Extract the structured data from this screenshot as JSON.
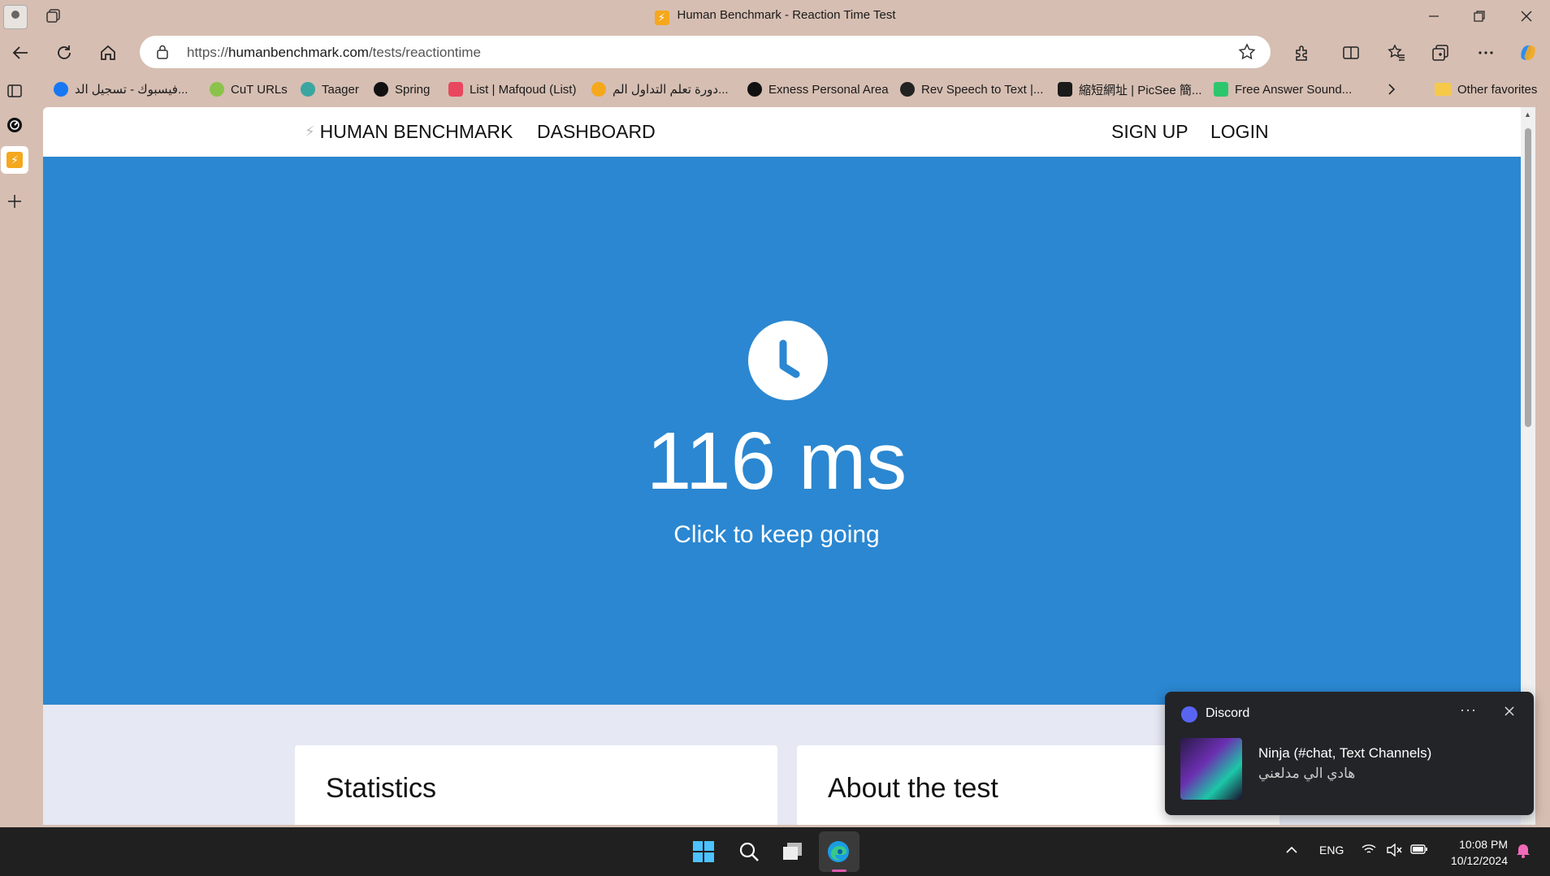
{
  "window": {
    "title": "Human Benchmark - Reaction Time Test"
  },
  "address_bar": {
    "url_prefix": "https://",
    "url_domain": "humanbenchmark.com",
    "url_path": "/tests/reactiontime"
  },
  "favorites": [
    {
      "label": "فيسبوك - تسجيل الد...",
      "icon": "facebook-icon",
      "color": "#1877f2"
    },
    {
      "label": "CuT URLs",
      "icon": "cut-urls-icon",
      "color": "#8bc34a"
    },
    {
      "label": "Taager",
      "icon": "taager-icon",
      "color": "#3aa6a0"
    },
    {
      "label": "Spring",
      "icon": "spring-icon",
      "color": "#111111"
    },
    {
      "label": "List | Mafqoud (List)",
      "icon": "clickup-icon",
      "color": "#e8475f"
    },
    {
      "label": "دورة تعلم التداول الم...",
      "icon": "course-icon",
      "color": "#f5a81c"
    },
    {
      "label": "Exness Personal Area",
      "icon": "exness-icon",
      "color": "#111111"
    },
    {
      "label": "Rev Speech to Text |...",
      "icon": "rev-icon",
      "color": "#222222"
    },
    {
      "label": "縮短網址 | PicSee 簡...",
      "icon": "picsee-icon",
      "color": "#1a1a1a"
    },
    {
      "label": "Free Answer Sound...",
      "icon": "pixabay-icon",
      "color": "#2ec66d"
    }
  ],
  "favorites_other": "Other favorites",
  "site": {
    "brand": "HUMAN BENCHMARK",
    "nav_dashboard": "DASHBOARD",
    "nav_signup": "SIGN UP",
    "nav_login": "LOGIN"
  },
  "test": {
    "result": "116 ms",
    "hint": "Click to keep going",
    "background_color": "#2b87d1"
  },
  "cards": {
    "statistics": "Statistics",
    "about": "About the test"
  },
  "notification": {
    "app": "Discord",
    "heading": "Ninja (#chat, Text Channels)",
    "body": "هادي الي مدلعني"
  },
  "taskbar": {
    "language": "ENG",
    "time": "10:08 PM",
    "date": "10/12/2024"
  }
}
